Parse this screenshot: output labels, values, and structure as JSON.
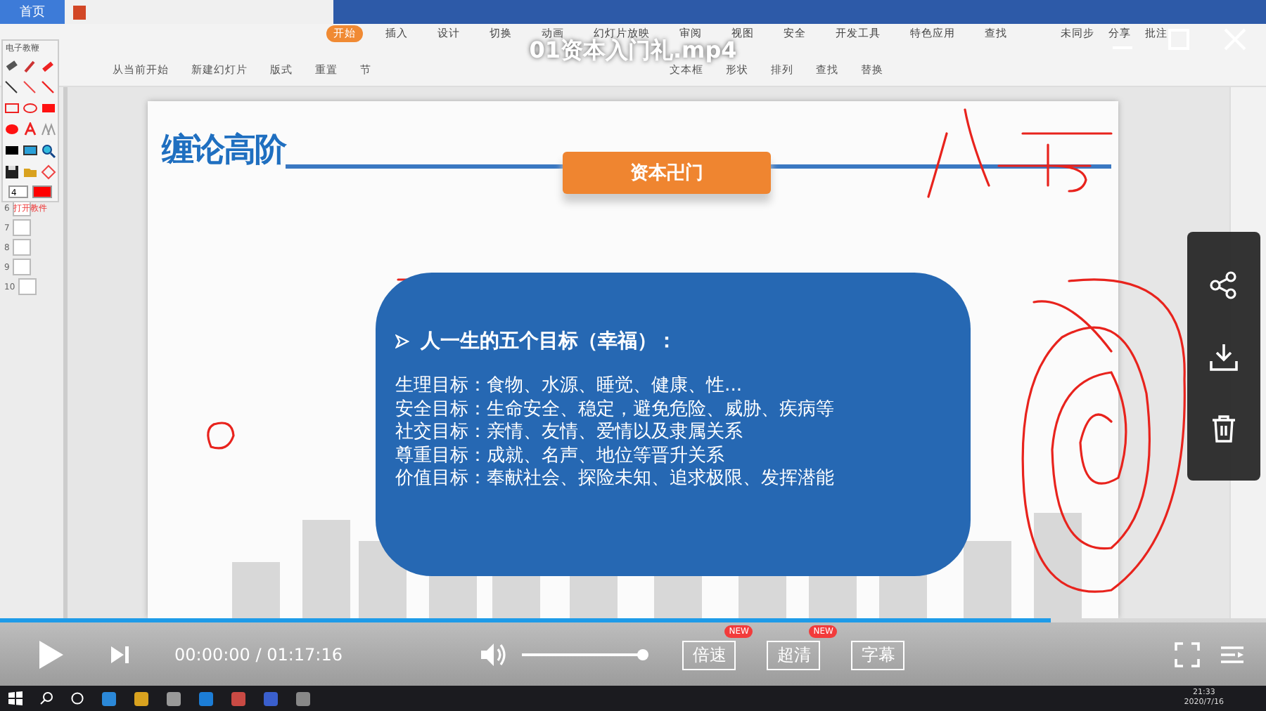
{
  "app": {
    "home_tab": "首页",
    "menu": [
      {
        "label": "开始",
        "selected": true
      },
      {
        "label": "插入",
        "selected": false
      },
      {
        "label": "设计",
        "selected": false
      },
      {
        "label": "切换",
        "selected": false
      },
      {
        "label": "动画",
        "selected": false
      },
      {
        "label": "幻灯片放映",
        "selected": false
      },
      {
        "label": "审阅",
        "selected": false
      },
      {
        "label": "视图",
        "selected": false
      },
      {
        "label": "安全",
        "selected": false
      },
      {
        "label": "开发工具",
        "selected": false
      },
      {
        "label": "特色应用",
        "selected": false
      },
      {
        "label": "查找",
        "selected": false
      }
    ],
    "menu_right": [
      "未同步",
      "分享",
      "批注"
    ],
    "ribbon": [
      "从当前开始",
      "新建幻灯片",
      "版式",
      "重置",
      "节",
      "文本框",
      "形状",
      "排列",
      "查找",
      "替换"
    ]
  },
  "pen_toolbox": {
    "title": "电子教鞭",
    "size": "4",
    "footer": "打开教件"
  },
  "thumbnails": [
    "6",
    "7",
    "8",
    "9",
    "10"
  ],
  "slide": {
    "title": "缠论高阶",
    "banner": "资本卍门",
    "heading": "人一生的五个目标（幸福）：",
    "lines": [
      "生理目标：食物、水源、睡觉、健康、性...",
      "安全目标：生命安全、稳定，避免危险、威胁、疾病等",
      "社交目标：亲情、友情、爱情以及隶属关系",
      "尊重目标：成就、名声、地位等晋升关系",
      "价值目标：奉献社会、探险未知、追求极限、发挥潜能"
    ]
  },
  "player": {
    "title": "01资本入门礼.mp4",
    "progress": {
      "level": 0.83
    },
    "time": "00:00:00 / 01:17:16",
    "volume": {
      "level": 1.0
    },
    "buttons": [
      {
        "label": "倍速",
        "badge": "NEW"
      },
      {
        "label": "超清",
        "badge": "NEW"
      },
      {
        "label": "字幕"
      }
    ]
  },
  "taskbar": {
    "time": "21:33",
    "date": "2020/7/16"
  }
}
